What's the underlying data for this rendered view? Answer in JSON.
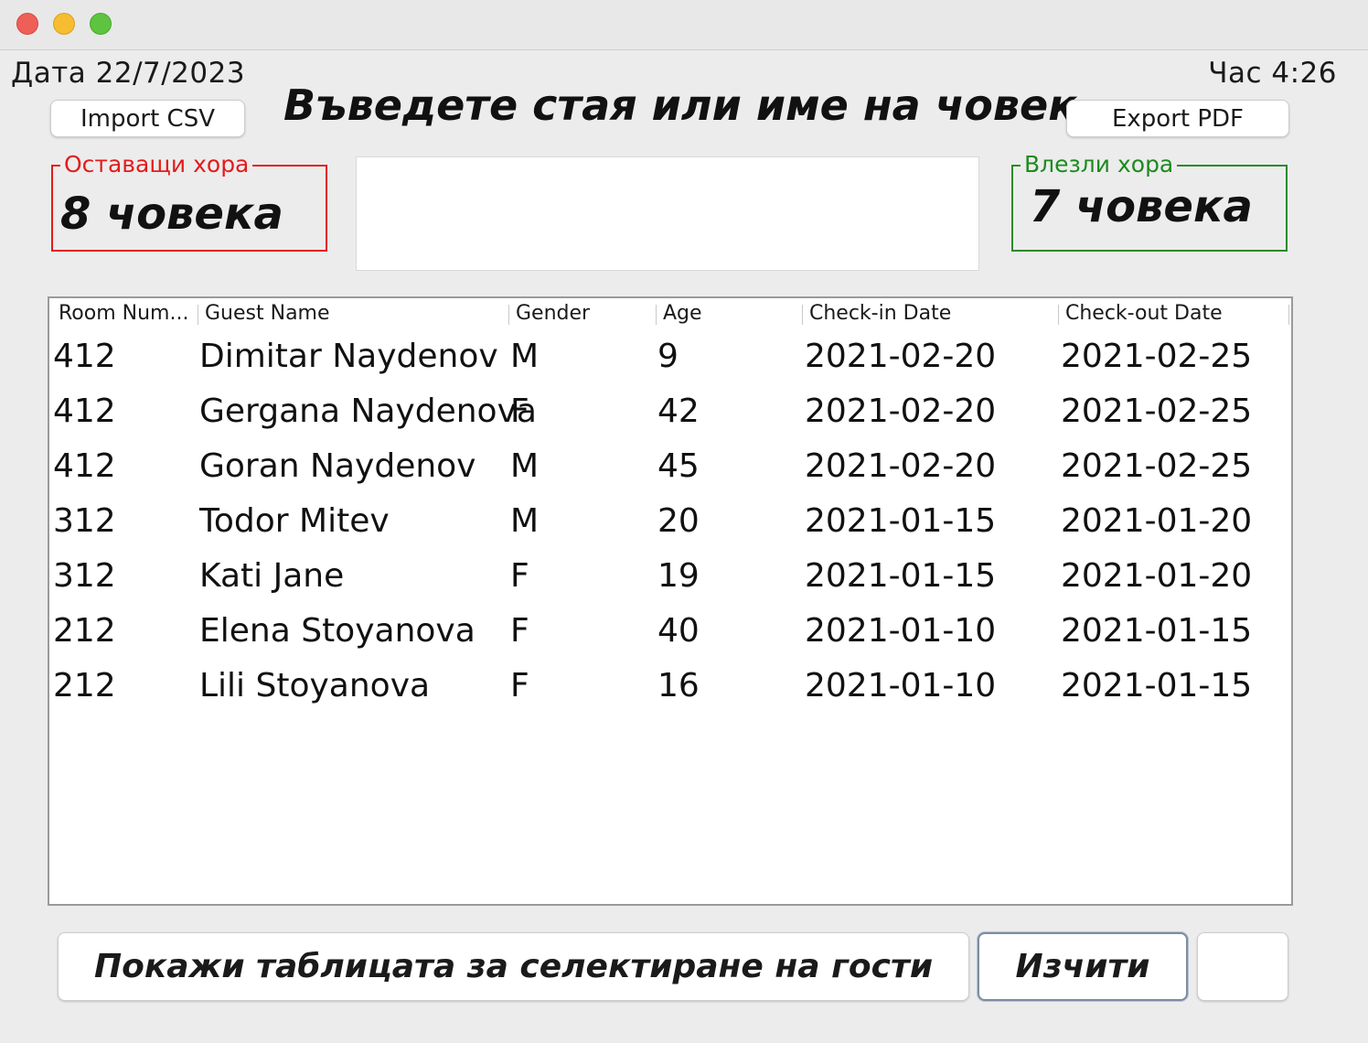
{
  "header": {
    "date": "Дата 22/7/2023",
    "time": "Час 4:26",
    "headline": "Въведете стая или име на човек",
    "import_label": "Import CSV",
    "export_label": "Export PDF"
  },
  "search": {
    "value": "",
    "placeholder": ""
  },
  "stats": {
    "remaining_legend": "Оставащи хора",
    "remaining_value": "8 човека",
    "entered_legend": "Влезли хора",
    "entered_value": "7 човека"
  },
  "table": {
    "columns": [
      "Room Num...",
      "Guest Name",
      "Gender",
      "Age",
      "Check-in Date",
      "Check-out Date"
    ],
    "rows": [
      [
        "412",
        "Dimitar Naydenov",
        "M",
        "9",
        "2021-02-20",
        "2021-02-25"
      ],
      [
        "412",
        "Gergana Naydenova",
        "F",
        "42",
        "2021-02-20",
        "2021-02-25"
      ],
      [
        "412",
        "Goran Naydenov",
        "M",
        "45",
        "2021-02-20",
        "2021-02-25"
      ],
      [
        "312",
        "Todor Mitev",
        "M",
        "20",
        "2021-01-15",
        "2021-01-20"
      ],
      [
        "312",
        "Kati Jane",
        "F",
        "19",
        "2021-01-15",
        "2021-01-20"
      ],
      [
        "212",
        "Elena Stoyanova",
        "F",
        "40",
        "2021-01-10",
        "2021-01-15"
      ],
      [
        "212",
        "Lili Stoyanova",
        "F",
        "16",
        "2021-01-10",
        "2021-01-15"
      ]
    ]
  },
  "footer": {
    "show_table_label": "Покажи таблицата за селектиране на гости",
    "clear_label": "Изчити",
    "extra_label": ""
  },
  "colors": {
    "remaining": "#e41b1b",
    "entered": "#1e8a1e"
  }
}
